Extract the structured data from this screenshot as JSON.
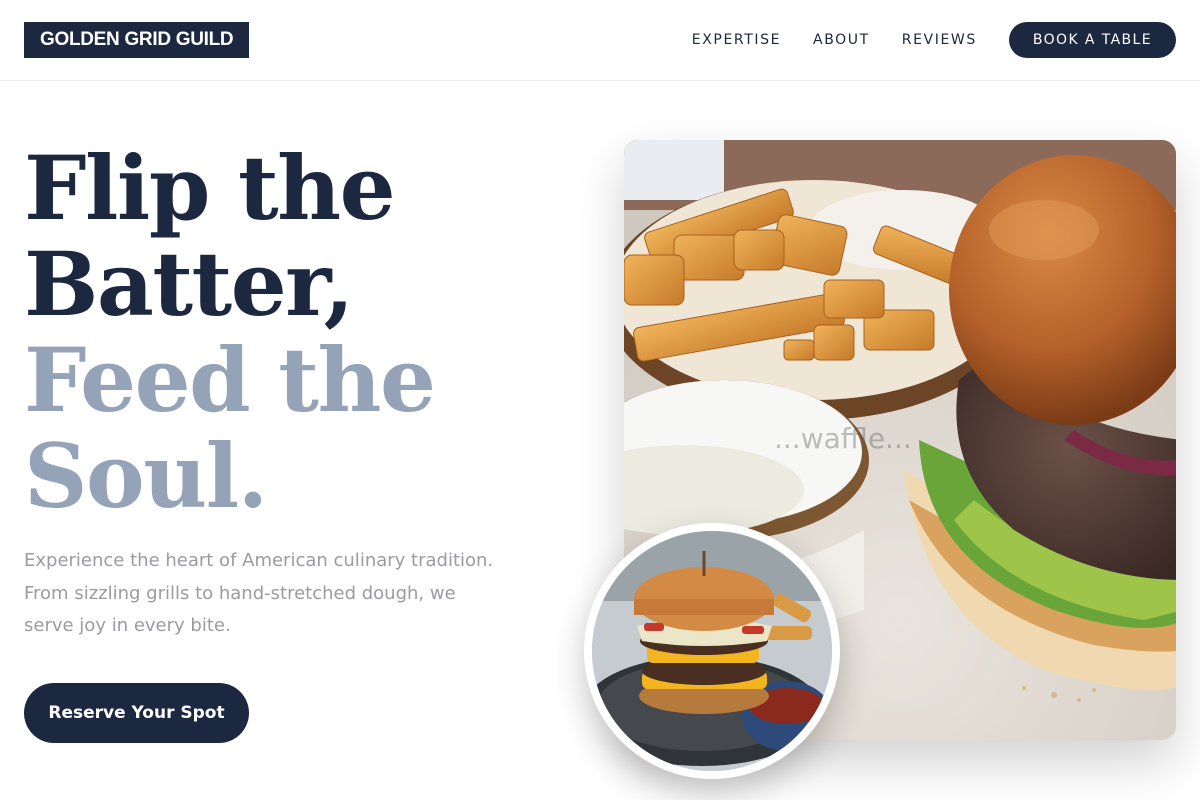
{
  "header": {
    "logo": "GOLDEN GRID GUILD",
    "nav": [
      "EXPERTISE",
      "ABOUT",
      "REVIEWS"
    ],
    "cta_label": "BOOK A TABLE"
  },
  "hero": {
    "headline_dark": [
      "Flip the",
      "Batter,"
    ],
    "headline_light": [
      "Feed the",
      "Soul."
    ],
    "description": "Experience the heart of American culinary tradition. From sizzling grills to hand-stretched dough, we serve joy in every bite.",
    "cta_label": "Reserve Your Spot"
  },
  "images": {
    "main_watermark": "...waffle..."
  },
  "colors": {
    "primary": "#1c2740",
    "accent_light": "#95a3b8",
    "muted_text": "#9b9ba0"
  }
}
